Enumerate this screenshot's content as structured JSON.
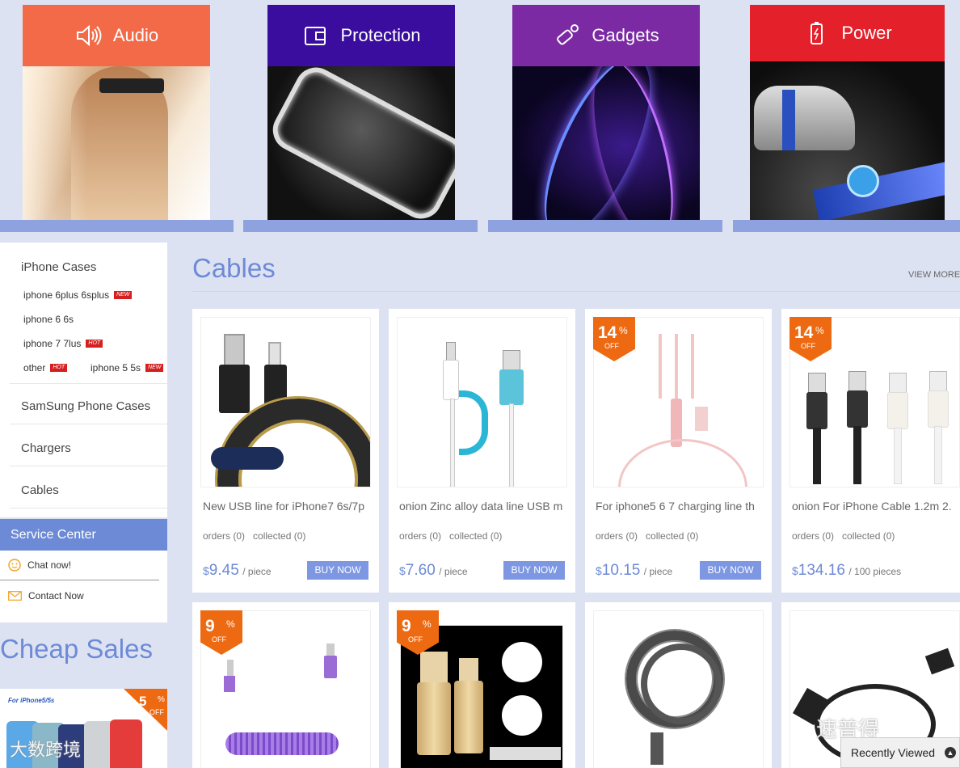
{
  "categories": [
    {
      "label": "Audio",
      "color": "#f26a47",
      "icon": "speaker-icon"
    },
    {
      "label": "Protection",
      "color": "#3a0d9e",
      "icon": "wallet-icon"
    },
    {
      "label": "Gadgets",
      "color": "#7b2aa3",
      "icon": "usb-stick-icon"
    },
    {
      "label": "Power",
      "color": "#e4202a",
      "icon": "battery-icon"
    }
  ],
  "sidebar": {
    "iphone_cases": "iPhone Cases",
    "items": [
      {
        "label": "iphone 6plus 6splus",
        "badge": "NEW"
      },
      {
        "label": "iphone 6 6s",
        "badge": ""
      },
      {
        "label": "iphone 7 7lus",
        "badge": "HOT"
      },
      {
        "label": "other",
        "badge": "HOT"
      },
      {
        "label": "iphone 5 5s",
        "badge": "NEW"
      }
    ],
    "samsung": "SamSung Phone Cases",
    "chargers": "Chargers",
    "cables": "Cables"
  },
  "service": {
    "title": "Service Center",
    "chat": "Chat now!",
    "contact": "Contact Now"
  },
  "cheap": {
    "title": "Cheap Sales",
    "promo_text": "For iPhone5/5s",
    "discount": "5",
    "pct": "%",
    "off": "OFF"
  },
  "section": {
    "title": "Cables",
    "view_more": "VIEW MORE"
  },
  "products": [
    {
      "name": "New USB line for iPhone7 6s/7p",
      "orders": "orders (0)",
      "collected": "collected (0)",
      "currency": "$",
      "price": "9.45",
      "unit": "/ piece",
      "buy": "BUY NOW",
      "discount": ""
    },
    {
      "name": "onion Zinc alloy data line USB m",
      "orders": "orders (0)",
      "collected": "collected (0)",
      "currency": "$",
      "price": "7.60",
      "unit": "/ piece",
      "buy": "BUY NOW",
      "discount": ""
    },
    {
      "name": "For iphone5 6 7 charging line th",
      "orders": "orders (0)",
      "collected": "collected (0)",
      "currency": "$",
      "price": "10.15",
      "unit": "/ piece",
      "buy": "BUY NOW",
      "discount": "14"
    },
    {
      "name": "onion For iPhone Cable 1.2m 2.",
      "orders": "orders (0)",
      "collected": "collected (0)",
      "currency": "$",
      "price": "134.16",
      "unit": "/ 100 pieces",
      "buy": "",
      "discount": "14"
    }
  ],
  "row2_discounts": [
    "9",
    "9"
  ],
  "discount_pct": "%",
  "discount_off": "OFF",
  "recently_viewed": "Recently Viewed",
  "watermark_left": "大数跨境",
  "watermark_right": "速普得"
}
